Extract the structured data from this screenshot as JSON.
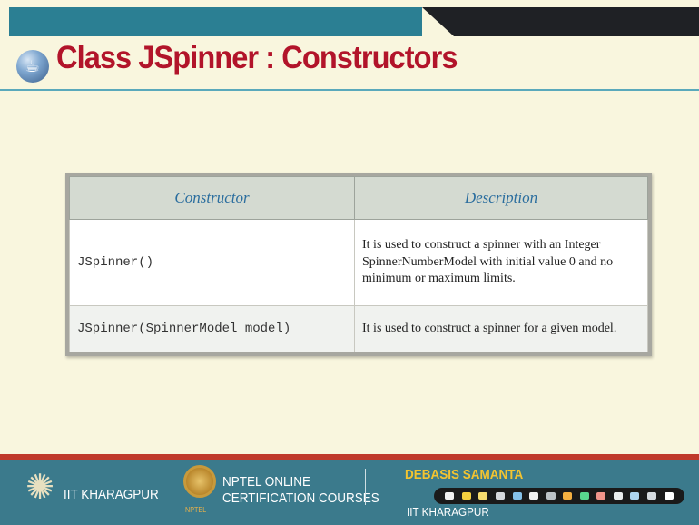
{
  "title": "Class JSpinner : Constructors",
  "logo_glyph": "☕",
  "table": {
    "headers": [
      "Constructor",
      "Description"
    ],
    "rows": [
      {
        "constructor": "JSpinner()",
        "description": "It is used to construct a spinner with an Integer SpinnerNumberModel with initial value 0 and no minimum or maximum limits."
      },
      {
        "constructor": "JSpinner(SpinnerModel model)",
        "description": "It is used to construct a spinner for a given model."
      }
    ]
  },
  "footer": {
    "institute": "IIT KHARAGPUR",
    "nptel_line1": "NPTEL ONLINE",
    "nptel_line2": "CERTIFICATION COURSES",
    "nptel_small": "NPTEL",
    "author": "DEBASIS SAMANTA",
    "author_institute": "IIT KHARAGPUR",
    "emblem_glyph": "✺"
  },
  "colors": {
    "title": "#b2142a",
    "header_text": "#2a6d9e",
    "teal": "#2b7f93",
    "footer": "#3b7a8c"
  }
}
